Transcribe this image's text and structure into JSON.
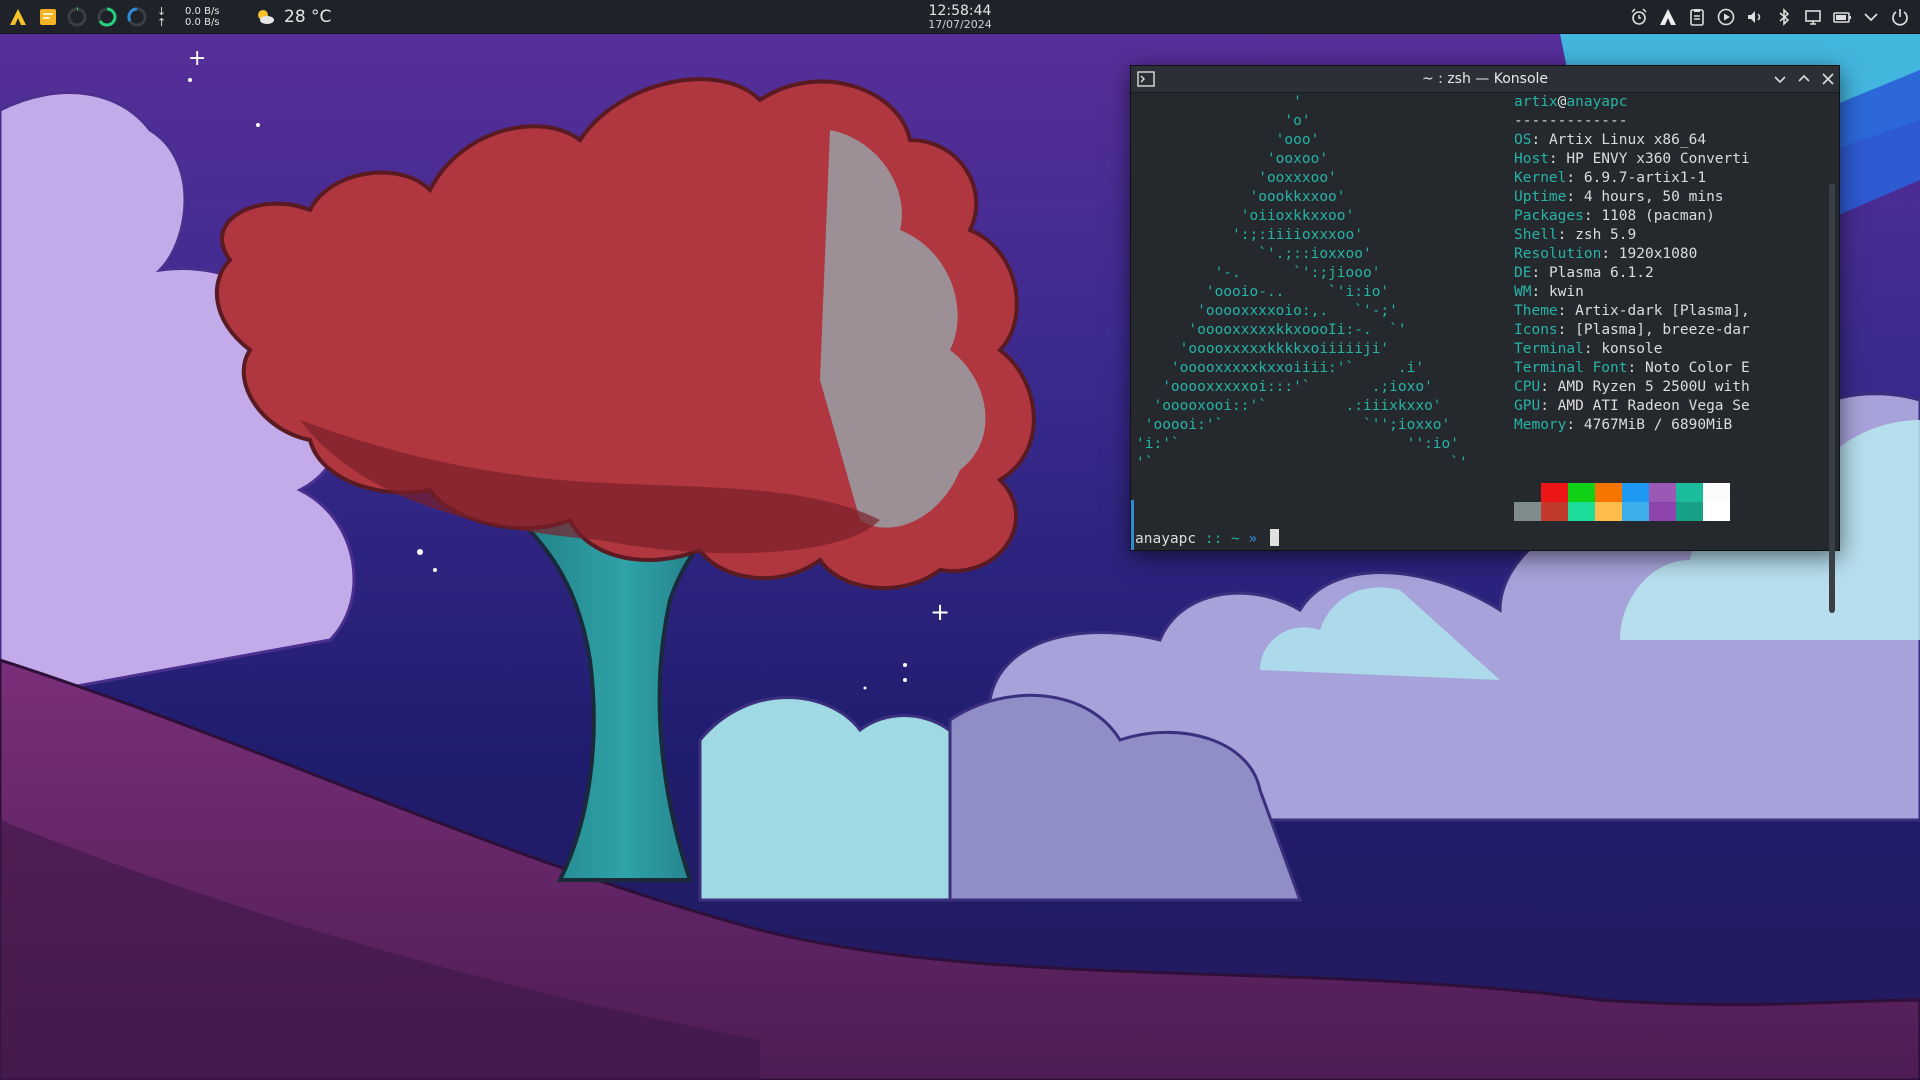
{
  "panel": {
    "net_down": "0.0 B/s",
    "net_up": "0.0 B/s",
    "net_down_arrow": "↓",
    "net_up_arrow": "↑",
    "weather_temp": "28 °C",
    "clock_time": "12:58:44",
    "clock_date": "17/07/2024",
    "icons": [
      "application-launcher-icon",
      "sticky-notes-icon",
      "cpu-monitor-icon",
      "memory-monitor-icon",
      "swap-monitor-icon",
      "weather-icon",
      "alarm-clock-icon",
      "input-method-icon",
      "clipboard-icon",
      "media-player-icon",
      "volume-icon",
      "bluetooth-icon",
      "display-icon",
      "battery-icon",
      "tray-expand-icon",
      "power-icon"
    ]
  },
  "konsole": {
    "title": "~ : zsh — Konsole",
    "ascii_art": "                  '\n                 'o'\n                'ooo'\n               'ooxoo'\n              'ooxxxoo'\n             'oookkxxoo'\n            'oiioxkkxxoo'\n           ':;:iiiioxxxoo'\n              `'.;::ioxxoo'\n         '-.      `':;jiooo'\n        'oooio-..     `'i:io'\n       'ooooxxxxoio:,.   `'-;'\n      'ooooxxxxxkkxoooIi:-.  `'\n     'ooooxxxxxkkkkxoiiiiiji'\n    'ooooxxxxxkxxoiiii:'`     .i'\n   'ooooxxxxxoi:::'`       .;ioxo'\n  'ooooxooi::'`         .:iiixkxxo'\n 'ooooi:'`                `'';ioxxo'\n'i:'`                          '':io'\n'`                                  `'",
    "user": "artix",
    "at": "@",
    "host": "anayapc",
    "separator": "-------------",
    "info": [
      {
        "key": "OS",
        "value": "Artix Linux x86_64"
      },
      {
        "key": "Host",
        "value": "HP ENVY x360 Converti"
      },
      {
        "key": "Kernel",
        "value": "6.9.7-artix1-1"
      },
      {
        "key": "Uptime",
        "value": "4 hours, 50 mins"
      },
      {
        "key": "Packages",
        "value": "1108 (pacman)"
      },
      {
        "key": "Shell",
        "value": "zsh 5.9"
      },
      {
        "key": "Resolution",
        "value": "1920x1080"
      },
      {
        "key": "DE",
        "value": "Plasma 6.1.2"
      },
      {
        "key": "WM",
        "value": "kwin"
      },
      {
        "key": "Theme",
        "value": "Artix-dark [Plasma],"
      },
      {
        "key": "Icons",
        "value": "[Plasma], breeze-dar"
      },
      {
        "key": "Terminal",
        "value": "konsole"
      },
      {
        "key": "Terminal Font",
        "value": "Noto Color E"
      },
      {
        "key": "CPU",
        "value": "AMD Ryzen 5 2500U with"
      },
      {
        "key": "GPU",
        "value": "AMD ATI Radeon Vega Se"
      },
      {
        "key": "Memory",
        "value": "4767MiB / 6890MiB"
      }
    ],
    "palette_top": [
      "#25292e",
      "#ed1515",
      "#11d116",
      "#f67400",
      "#1d99f3",
      "#9b59b6",
      "#1abc9c",
      "#fcfcfc"
    ],
    "palette_bottom": [
      "#7f8c8d",
      "#c0392b",
      "#1cdc9a",
      "#fdbc4b",
      "#3daee9",
      "#8e44ad",
      "#16a085",
      "#ffffff"
    ],
    "prompt": {
      "host": "anayapc",
      "sep": " :: ",
      "tilde": "~",
      "arrow": " » "
    }
  }
}
